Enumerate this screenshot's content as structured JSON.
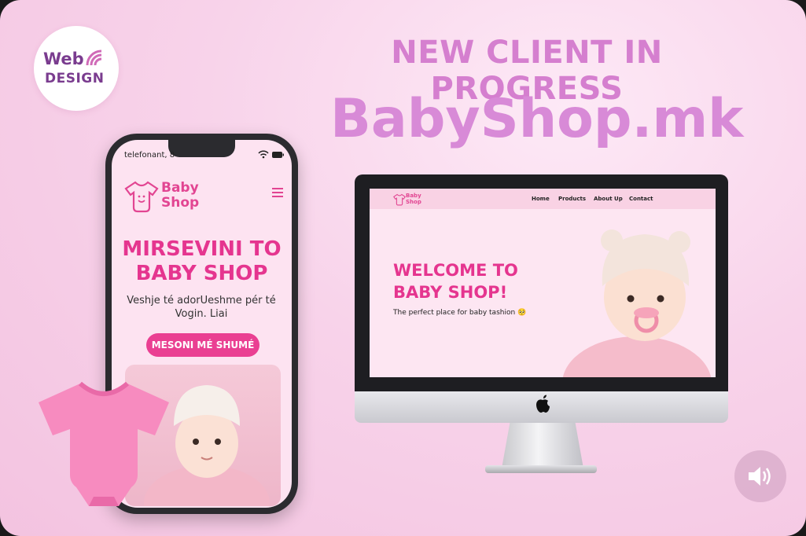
{
  "header": {
    "logo_top": "Web",
    "logo_bottom": "DESIGN",
    "headline": "NEW CLIENT IN PROGRESS",
    "brand": "BabyShop.mk"
  },
  "phone": {
    "carrier": "telefonant, 8",
    "logo_line1": "Baby",
    "logo_line2": "Shop",
    "title_line1": "MIRSEVINI TO",
    "title_line2": "BABY SHOP",
    "subtitle": "Veshje té adorUeshme pér té Vogin. Liai",
    "cta": "MESONI MÉ SHUMÉ"
  },
  "desktop": {
    "logo_line1": "Baby",
    "logo_line2": "Shop",
    "nav": [
      "Home",
      "Products",
      "About Up",
      "Contact"
    ],
    "title_line1": "WELCOME TO",
    "title_line2": "BABY SHOP!",
    "subtitle": "The perfect place for baby tashion 🥺"
  },
  "icons": {
    "logo": "wifi-icon",
    "menu": "hamburger-icon",
    "onesie": "onesie-icon",
    "apple": "apple-logo-icon",
    "sound": "speaker-icon"
  },
  "colors": {
    "accent": "#e5358f",
    "headline": "#d57fcf",
    "background": "#f8d3ea"
  }
}
